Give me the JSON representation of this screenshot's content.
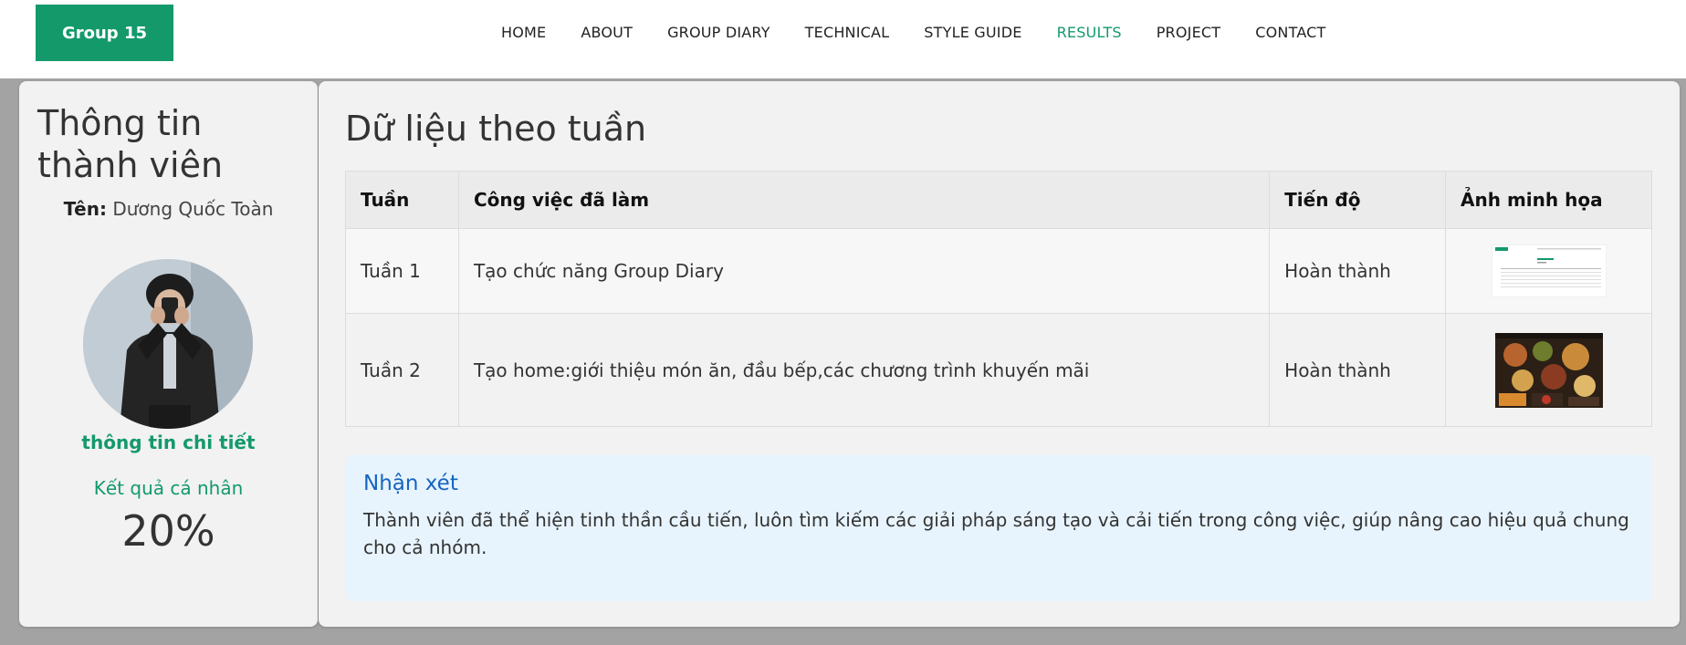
{
  "header": {
    "logo": "Group 15",
    "nav": [
      {
        "label": "HOME",
        "active": false
      },
      {
        "label": "ABOUT",
        "active": false
      },
      {
        "label": "GROUP DIARY",
        "active": false
      },
      {
        "label": "TECHNICAL",
        "active": false
      },
      {
        "label": "STYLE GUIDE",
        "active": false
      },
      {
        "label": "RESULTS",
        "active": true
      },
      {
        "label": "PROJECT",
        "active": false
      },
      {
        "label": "CONTACT",
        "active": false
      }
    ]
  },
  "member": {
    "title": "Thông tin thành viên",
    "name_label": "Tên:",
    "name_value": "Dương Quốc Toàn",
    "detail_link": "thông tin chi tiết",
    "result_label": "Kết quả cá nhân",
    "result_value": "20%"
  },
  "weekly": {
    "title": "Dữ liệu theo tuần",
    "columns": [
      "Tuần",
      "Công việc đã làm",
      "Tiến độ",
      "Ảnh minh họa"
    ],
    "rows": [
      {
        "week": "Tuần 1",
        "task": "Tạo chức năng Group Diary",
        "status": "Hoàn thành",
        "image": "group-diary-screenshot"
      },
      {
        "week": "Tuần 2",
        "task": "Tạo home:giới thiệu món ăn, đầu bếp,các chương trình khuyến mãi",
        "status": "Hoàn thành",
        "image": "home-food-screenshot"
      }
    ]
  },
  "comment": {
    "title": "Nhận xét",
    "body": "Thành viên đã thể hiện tinh thần cầu tiến, luôn tìm kiếm các giải pháp sáng tạo và cải tiến trong công việc, giúp nâng cao hiệu quả chung cho cả nhóm."
  },
  "colors": {
    "brand": "#14996b",
    "page_bg": "#a3a3a3",
    "card_bg": "#f2f2f2",
    "comment_bg": "#e8f4fd",
    "comment_title": "#1565c0"
  }
}
